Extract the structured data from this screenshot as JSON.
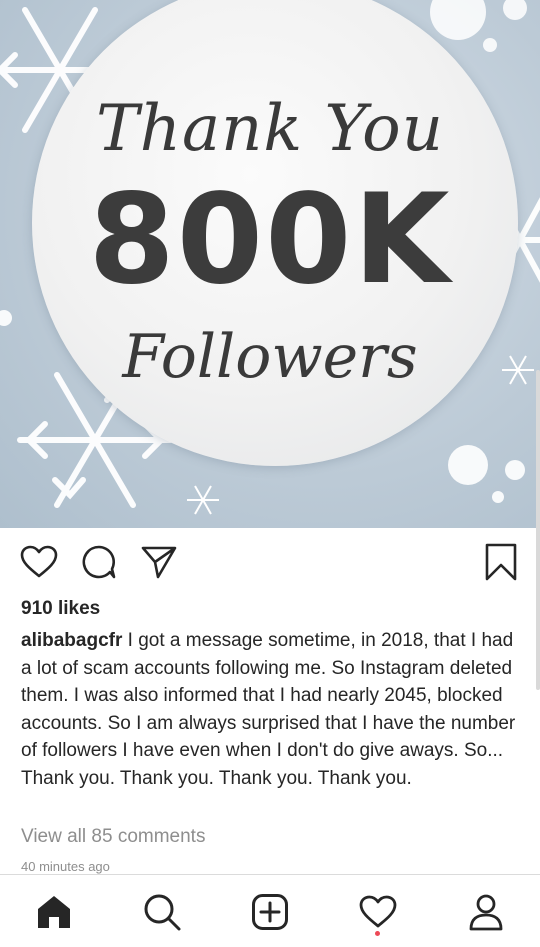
{
  "post": {
    "image": {
      "line1": "Thank You",
      "line2": "800K",
      "line3": "Followers"
    },
    "likes": "910 likes",
    "username": "alibabagcfr",
    "caption": "I got a message sometime, in 2018, that I had a lot of scam accounts following me. So Instagram deleted them. I was also informed that I had nearly 2045, blocked accounts. So I am always surprised that I have the number of followers I have even when I don't do give aways. So... Thank you. Thank you. Thank you. Thank you.",
    "view_comments": "View all 85 comments",
    "timestamp": "40 minutes ago"
  },
  "actions": [
    "heart-icon",
    "comment-icon",
    "share-icon",
    "bookmark-icon"
  ],
  "nav": [
    "home-icon",
    "search-icon",
    "add-icon",
    "activity-icon",
    "profile-icon"
  ],
  "colors": {
    "text": "#262626",
    "muted": "#8e8e8e",
    "notification": "#ed4956"
  }
}
